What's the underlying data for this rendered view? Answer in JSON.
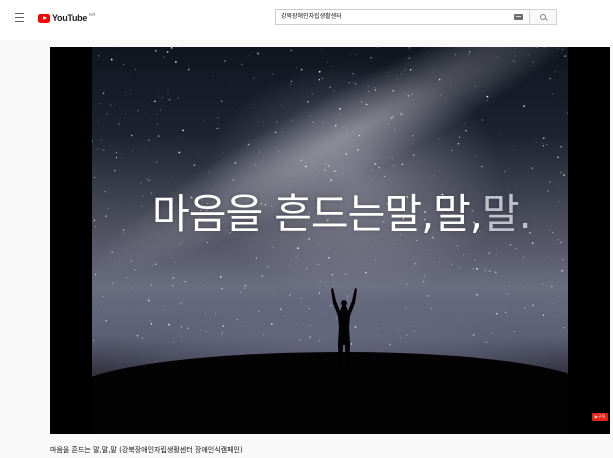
{
  "header": {
    "menu_icon": "hamburger-menu-icon",
    "logo_text": "YouTube",
    "logo_country": "KR",
    "search": {
      "value": "강북장애인자립생활센터",
      "keyboard_icon": "keyboard-icon",
      "search_icon": "search-icon"
    }
  },
  "player": {
    "overlay_text": "마음을 흔드는말,말,",
    "overlay_text_faded": "말.",
    "subscribe_label": "▶구독"
  },
  "video": {
    "title": "마음을 흔드는 말,말,말 (강북장애인자립생활센터 장애인식캠페인)"
  },
  "colors": {
    "brand_red": "#ff0000",
    "subscribe_red": "#e62117",
    "page_bg": "#f9f9f9"
  }
}
